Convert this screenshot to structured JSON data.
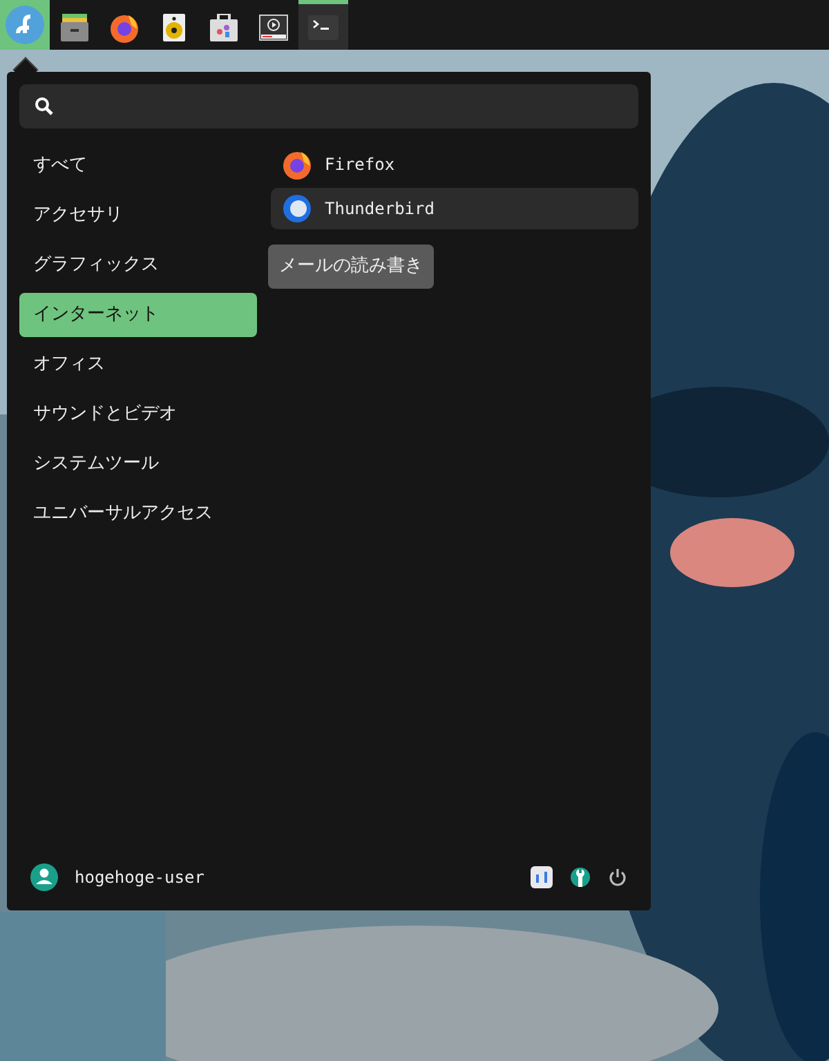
{
  "taskbar": {
    "start_selected": true,
    "apps": [
      {
        "kind": "files",
        "active": false
      },
      {
        "kind": "firefox",
        "active": false
      },
      {
        "kind": "speaker",
        "active": false
      },
      {
        "kind": "store",
        "active": false
      },
      {
        "kind": "video",
        "active": false
      },
      {
        "kind": "terminal",
        "active": true
      }
    ]
  },
  "menu": {
    "categories": [
      {
        "label": "すべて",
        "selected": false
      },
      {
        "label": "アクセサリ",
        "selected": false
      },
      {
        "label": "グラフィックス",
        "selected": false
      },
      {
        "label": "インターネット",
        "selected": true
      },
      {
        "label": "オフィス",
        "selected": false
      },
      {
        "label": "サウンドとビデオ",
        "selected": false
      },
      {
        "label": "システムツール",
        "selected": false
      },
      {
        "label": "ユニバーサルアクセス",
        "selected": false
      }
    ],
    "apps": [
      {
        "kind": "firefox",
        "label": "Firefox",
        "selected": false
      },
      {
        "kind": "thunderbird",
        "label": "Thunderbird",
        "selected": true
      }
    ],
    "tooltip": "メールの読み書き",
    "user": "hogehoge-user"
  }
}
